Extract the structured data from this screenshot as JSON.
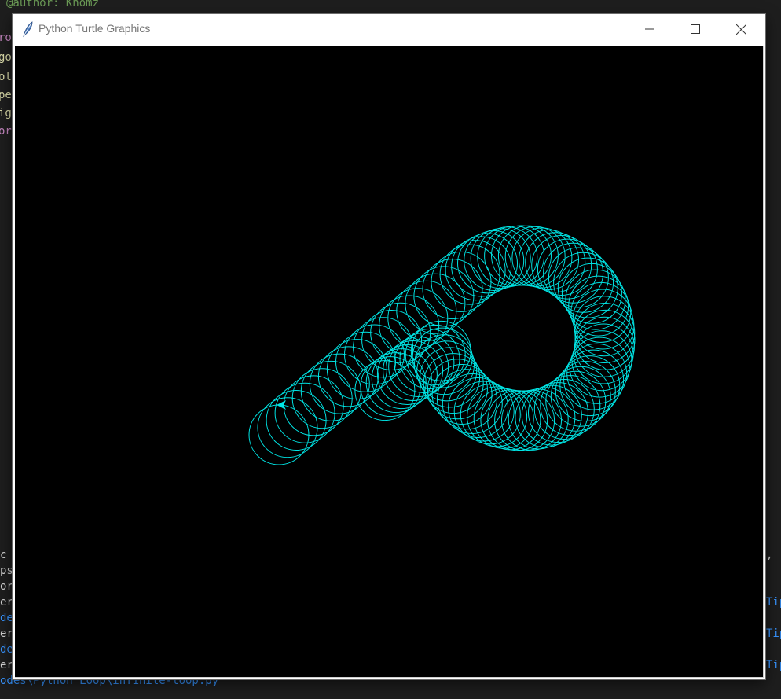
{
  "background_editor": {
    "top_line": "@author: Khomz",
    "left_fragments": [
      {
        "text": "ro",
        "color": "#c586c0"
      },
      {
        "text": "go",
        "color": "#dcdcaa"
      },
      {
        "text": "ol",
        "color": "#dcdcaa"
      },
      {
        "text": "pe",
        "color": "#dcdcaa"
      },
      {
        "text": "ig",
        "color": "#dcdcaa"
      },
      {
        "text": "or",
        "color": "#c586c0"
      }
    ],
    "panel_left": [
      "c",
      "ps",
      "or",
      "er",
      "de",
      "er",
      "de",
      "er"
    ],
    "panel_right": [
      ", ",
      "Tip",
      "Tip",
      "Tip"
    ],
    "bottom_path": "odes\\Python Loop\\infinite-loop.py"
  },
  "window": {
    "title": "Python Turtle Graphics",
    "icon": "feather-icon",
    "buttons": {
      "minimize": "minimize-icon",
      "maximize": "maximize-icon",
      "close": "close-icon"
    }
  },
  "canvas": {
    "background": "#000000",
    "pen_color": "#00e5e5"
  }
}
